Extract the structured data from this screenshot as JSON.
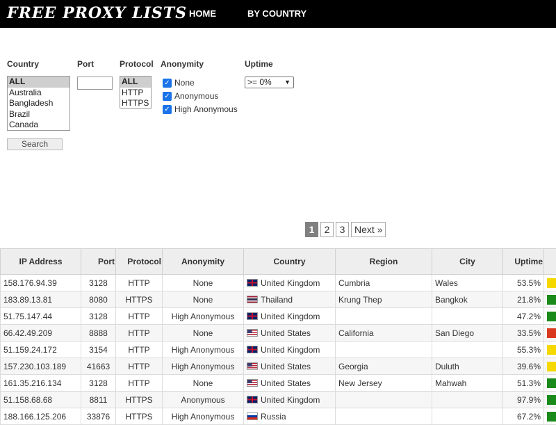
{
  "header": {
    "logo": "FREE PROXY LISTS",
    "nav": [
      {
        "label": "HOME"
      },
      {
        "label": "BY COUNTRY"
      }
    ]
  },
  "filters": {
    "country_label": "Country",
    "country_options": [
      "ALL",
      "Australia",
      "Bangladesh",
      "Brazil",
      "Canada"
    ],
    "port_label": "Port",
    "port_value": "",
    "protocol_label": "Protocol",
    "protocol_options": [
      "ALL",
      "HTTP",
      "HTTPS"
    ],
    "anonymity_label": "Anonymity",
    "anonymity_options": [
      {
        "label": "None",
        "checked": true
      },
      {
        "label": "Anonymous",
        "checked": true
      },
      {
        "label": "High Anonymous",
        "checked": true
      }
    ],
    "uptime_label": "Uptime",
    "uptime_value": ">= 0%",
    "search_label": "Search"
  },
  "pagination": {
    "pages": [
      "1",
      "2",
      "3"
    ],
    "active": "1",
    "next_label": "Next »"
  },
  "table": {
    "headers": [
      "IP Address",
      "Port",
      "Protocol",
      "Anonymity",
      "Country",
      "Region",
      "City",
      "Uptime"
    ],
    "status_colors": {
      "yellow": "#f5d800",
      "green": "#1a8a1a",
      "red": "#d9381e"
    },
    "rows": [
      {
        "ip": "158.176.94.39",
        "port": "3128",
        "protocol": "HTTP",
        "anonymity": "None",
        "flag": "uk-flag-icon",
        "country": "United Kingdom",
        "region": "Cumbria",
        "city": "Wales",
        "uptime": "53.5%",
        "status": "yellow"
      },
      {
        "ip": "183.89.13.81",
        "port": "8080",
        "protocol": "HTTPS",
        "anonymity": "None",
        "flag": "thailand-flag-icon",
        "country": "Thailand",
        "region": "Krung Thep",
        "city": "Bangkok",
        "uptime": "21.8%",
        "status": "green"
      },
      {
        "ip": "51.75.147.44",
        "port": "3128",
        "protocol": "HTTP",
        "anonymity": "High Anonymous",
        "flag": "uk-flag-icon",
        "country": "United Kingdom",
        "region": "",
        "city": "",
        "uptime": "47.2%",
        "status": "green"
      },
      {
        "ip": "66.42.49.209",
        "port": "8888",
        "protocol": "HTTP",
        "anonymity": "None",
        "flag": "us-flag-icon",
        "country": "United States",
        "region": "California",
        "city": "San Diego",
        "uptime": "33.5%",
        "status": "red"
      },
      {
        "ip": "51.159.24.172",
        "port": "3154",
        "protocol": "HTTP",
        "anonymity": "High Anonymous",
        "flag": "uk-flag-icon",
        "country": "United Kingdom",
        "region": "",
        "city": "",
        "uptime": "55.3%",
        "status": "yellow"
      },
      {
        "ip": "157.230.103.189",
        "port": "41663",
        "protocol": "HTTP",
        "anonymity": "High Anonymous",
        "flag": "us-flag-icon",
        "country": "United States",
        "region": "Georgia",
        "city": "Duluth",
        "uptime": "39.6%",
        "status": "yellow"
      },
      {
        "ip": "161.35.216.134",
        "port": "3128",
        "protocol": "HTTP",
        "anonymity": "None",
        "flag": "us-flag-icon",
        "country": "United States",
        "region": "New Jersey",
        "city": "Mahwah",
        "uptime": "51.3%",
        "status": "green"
      },
      {
        "ip": "51.158.68.68",
        "port": "8811",
        "protocol": "HTTPS",
        "anonymity": "Anonymous",
        "flag": "uk-flag-icon",
        "country": "United Kingdom",
        "region": "",
        "city": "",
        "uptime": "97.9%",
        "status": "green"
      },
      {
        "ip": "188.166.125.206",
        "port": "33876",
        "protocol": "HTTPS",
        "anonymity": "High Anonymous",
        "flag": "russia-flag-icon",
        "country": "Russia",
        "region": "",
        "city": "",
        "uptime": "67.2%",
        "status": "green"
      }
    ]
  }
}
